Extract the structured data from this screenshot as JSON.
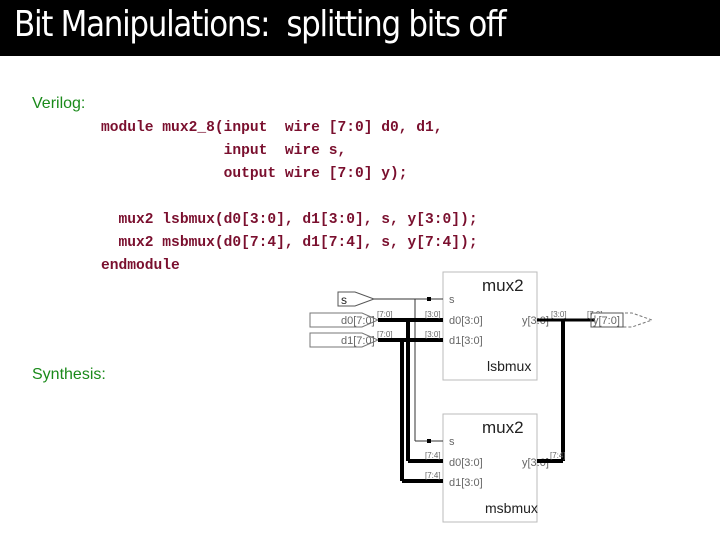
{
  "slide": {
    "title": "Bit Manipulations:  splitting bits off"
  },
  "sections": {
    "verilog_label": "Verilog:",
    "synthesis_label": "Synthesis:"
  },
  "code_lines": [
    "module mux2_8(input  wire [7:0] d0, d1,",
    "              input  wire s,",
    "              output wire [7:0] y);",
    "",
    "  mux2 lsbmux(d0[3:0], d1[3:0], s, y[3:0]);",
    "  mux2 msbmux(d0[7:4], d1[7:4], s, y[7:4]);",
    "endmodule"
  ],
  "schematic": {
    "inputs": {
      "s": "s",
      "d0": "d0[7:0]",
      "d1": "d1[7:0]",
      "d0_bus": "[7:0]",
      "d1_bus": "[7:0]"
    },
    "output": {
      "y": "y[7:0]",
      "y_bus": "[7:0]"
    },
    "lsbmux": {
      "type": "mux2",
      "instance": "lsbmux",
      "port_s": "s",
      "port_d0": "d0[3:0]",
      "port_d1": "d1[3:0]",
      "port_y": "y[3:0]",
      "tap_d0": "[3:0]",
      "tap_d1": "[3:0]",
      "tap_y": "[3:0]"
    },
    "msbmux": {
      "type": "mux2",
      "instance": "msbmux",
      "port_s": "s",
      "port_d0": "d0[3:0]",
      "port_d1": "d1[3:0]",
      "port_y": "y[3:0]",
      "tap_d0": "[7:4]",
      "tap_d1": "[7:4]",
      "tap_y": "[7:4]"
    }
  }
}
